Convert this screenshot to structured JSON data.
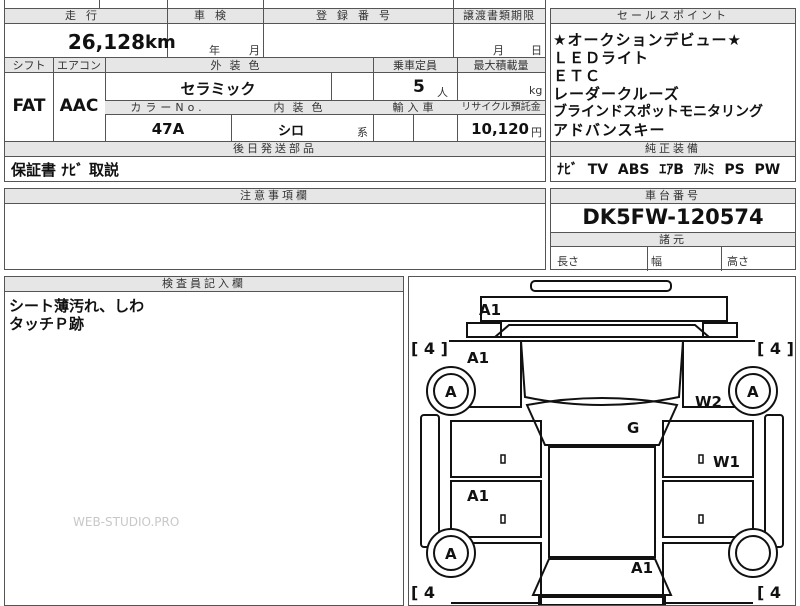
{
  "top": {
    "mileage_header": "走行",
    "inspection_header": "車検",
    "registration_header": "登録番号",
    "transfer_header": "譲渡書類期限",
    "mileage_value": "26,128",
    "mileage_unit": "km",
    "year_label": "年",
    "month_label": "月",
    "transfer_month": "月",
    "transfer_day": "日"
  },
  "mid": {
    "shift_header": "シフト",
    "ac_header": "エアコン",
    "exterior_header": "外装色",
    "capacity_header": "乗車定員",
    "load_header": "最大積載量",
    "shift_value": "FAT",
    "ac_value": "AAC",
    "exterior_value": "セラミック",
    "capacity_value": "5",
    "capacity_unit": "人",
    "load_unit": "kg",
    "color_no_header": "カラーNo.",
    "interior_header": "内装色",
    "import_header": "輸入車",
    "recycle_header": "リサイクル預託金",
    "color_no_value": "47A",
    "interior_value": "シロ",
    "interior_suffix": "系",
    "recycle_value": "10,120",
    "recycle_unit": "円"
  },
  "later_parts": {
    "header": "後日発送部品",
    "value": "保証書 ﾅﾋﾞ 取説"
  },
  "caution": {
    "header": "注意事項欄"
  },
  "sales_point": {
    "header": "セールスポイント",
    "lines": [
      "★オークションデビュー★",
      "ＬＥＤライト",
      "ＥＴＣ",
      "レーダークルーズ",
      "ブラインドスポットモニタリング",
      "アドバンスキー"
    ]
  },
  "equipment": {
    "header": "純正装備",
    "value": "ﾅﾋﾞ  TV  ABS  ｴｱB  ｱﾙﾐ  PS  PW"
  },
  "chassis": {
    "header": "車台番号",
    "value": "DK5FW-120574"
  },
  "dimensions": {
    "header": "諸元",
    "length_label": "長さ",
    "width_label": "幅",
    "height_label": "高さ"
  },
  "inspector": {
    "header": "検査員記入欄",
    "notes": [
      "シート薄汚れ、しわ",
      "タッチＰ跡"
    ],
    "watermark": "WEB-STUDIO.PRO"
  },
  "diagram": {
    "marks": {
      "front_bumper": "A1",
      "hood_left": "A1",
      "roof": "G",
      "front_door_right": "W2",
      "rear_door_right": "W1",
      "rear_door_left": "A1",
      "rear_bumper": "A1",
      "tire_fl": "A",
      "tire_fr": "A",
      "tire_rl": "A"
    },
    "tire_brackets": {
      "fl": "[ 4 ]",
      "fr": "[ 4 ]",
      "rl": "[ 4",
      "rr": "[ 4"
    }
  }
}
